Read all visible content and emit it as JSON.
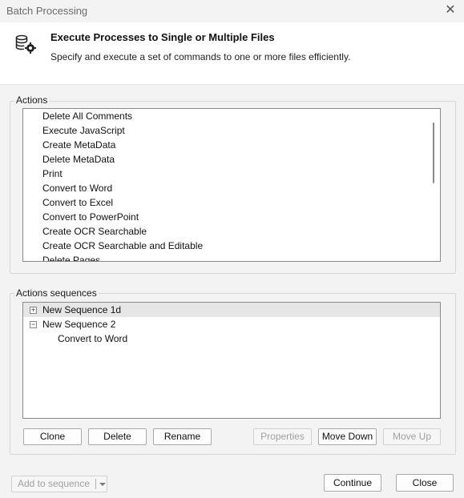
{
  "window": {
    "title": "Batch Processing",
    "close_glyph": "✕"
  },
  "header": {
    "icon": "batch-gear-icon",
    "title": "Execute Processes to Single or Multiple Files",
    "subtitle": "Specify and execute a set of commands to one or more files efficiently."
  },
  "actions": {
    "label": "Actions",
    "items": [
      "Delete All Comments",
      "Execute JavaScript",
      "Create MetaData",
      "Delete MetaData",
      "Print",
      "Convert to Word",
      "Convert to Excel",
      "Convert to PowerPoint",
      "Create OCR Searchable",
      "Create OCR Searchable and Editable",
      "Delete Pages"
    ]
  },
  "sequences": {
    "label": "Actions sequences",
    "tree": [
      {
        "label": "New Sequence 1d",
        "expander": "+",
        "selected": true
      },
      {
        "label": "New Sequence 2",
        "expander": "−",
        "selected": false
      },
      {
        "label": "Convert to Word",
        "child": true
      }
    ],
    "buttons": {
      "clone": "Clone",
      "delete": "Delete",
      "rename": "Rename",
      "properties": "Properties",
      "move_down": "Move Down",
      "move_up": "Move Up"
    }
  },
  "footer": {
    "add_to_sequence": "Add to sequence",
    "continue": "Continue",
    "close": "Close"
  }
}
